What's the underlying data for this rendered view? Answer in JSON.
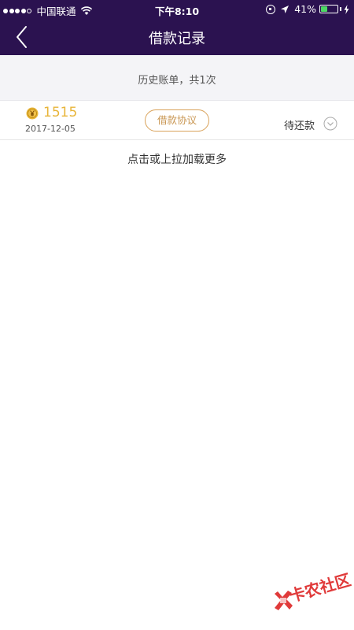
{
  "status_bar": {
    "carrier": "中国联通",
    "time": "下午8:10",
    "battery": "41%",
    "battery_level": 0.41
  },
  "nav": {
    "title": "借款记录"
  },
  "summary": {
    "text": "历史账单，共1次"
  },
  "records": [
    {
      "amount": "1515",
      "date": "2017-12-05",
      "agreement_label": "借款协议",
      "status": "待还款"
    }
  ],
  "load_more": "点击或上拉加载更多",
  "watermark": {
    "text": "卡农社区"
  },
  "colors": {
    "header": "#2b1250",
    "amount": "#e8b53a",
    "agreement": "#c89550",
    "watermark": "#e03a3a"
  },
  "icons": [
    "wifi-icon",
    "rotation-lock-icon",
    "location-arrow-icon",
    "battery-icon",
    "charging-bolt-icon",
    "back-chevron-icon",
    "yuan-coin-icon",
    "chevron-down-circle-icon"
  ]
}
